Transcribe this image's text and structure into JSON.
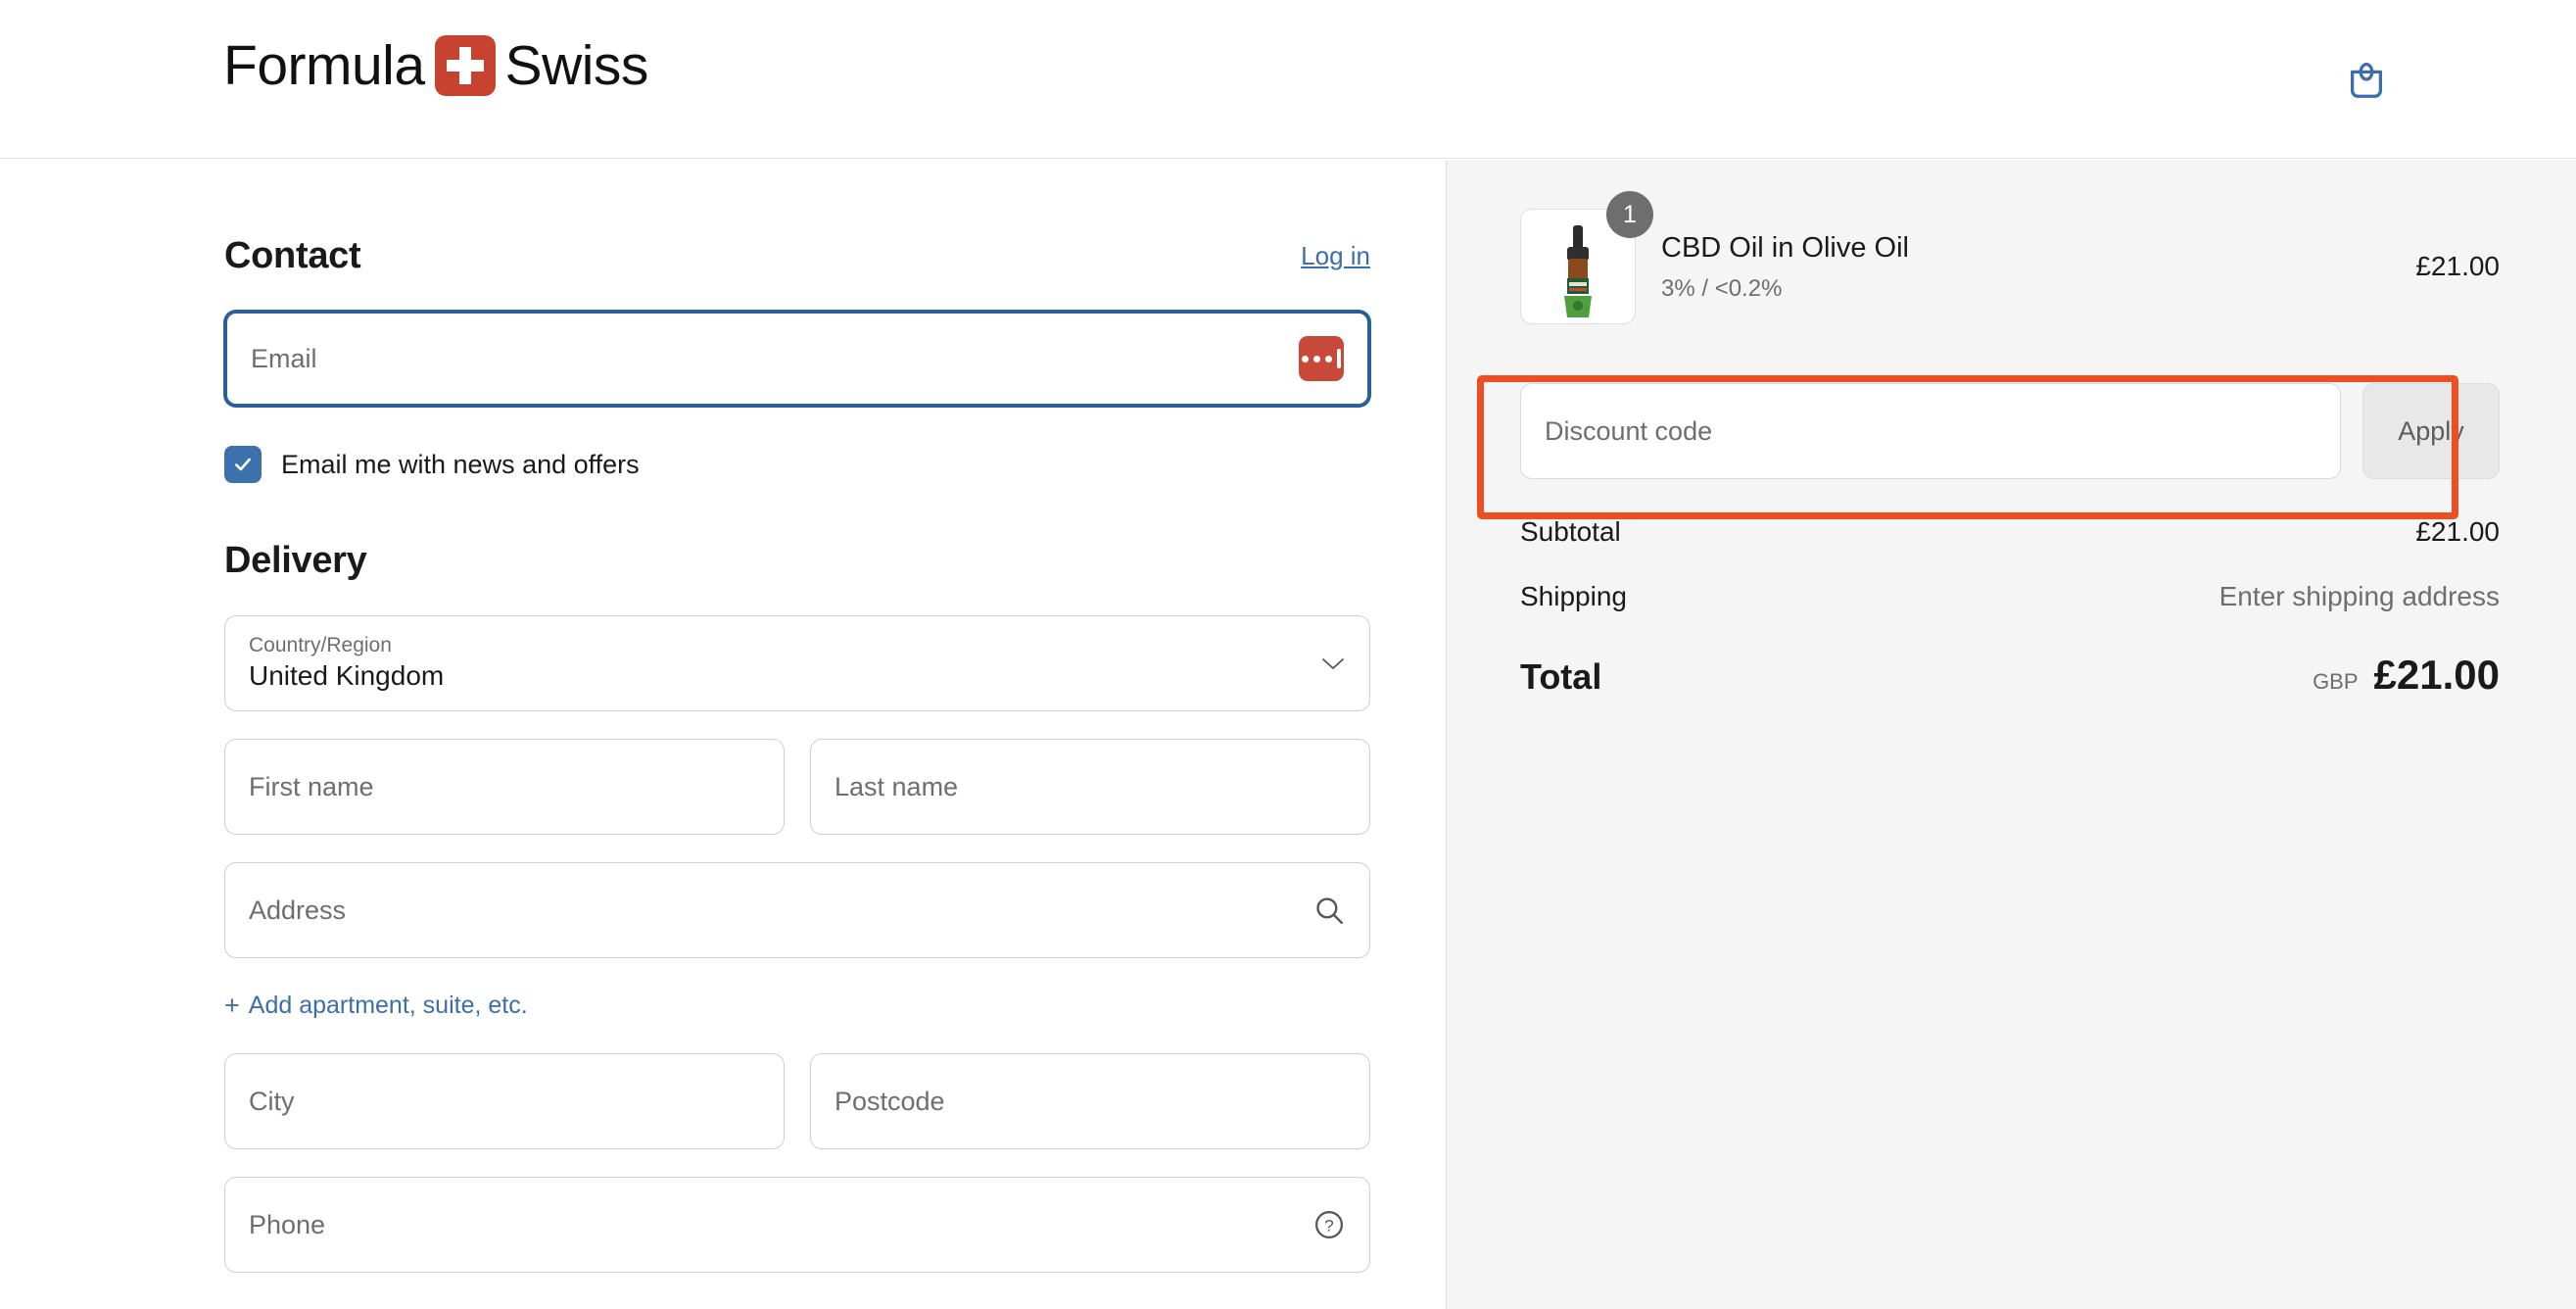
{
  "header": {
    "logo_text_left": "Formula",
    "logo_text_right": "Swiss",
    "logo_icon": "swiss-cross-icon",
    "cart_icon": "shopping-bag-icon",
    "brand_red": "#c8432f",
    "cart_icon_color": "#3b6eaa"
  },
  "contact": {
    "title": "Contact",
    "login_label": "Log in",
    "email_placeholder": "Email",
    "email_value": "",
    "autofill_icon": "password-manager-icon",
    "newsletter_label": "Email me with news and offers",
    "newsletter_checked": true
  },
  "delivery": {
    "title": "Delivery",
    "country_label": "Country/Region",
    "country_value": "United Kingdom",
    "country_chevron": "chevron-down-icon",
    "first_name_placeholder": "First name",
    "last_name_placeholder": "Last name",
    "address_placeholder": "Address",
    "address_icon": "search-icon",
    "add_apartment_label": "Add apartment, suite, etc.",
    "add_apartment_plus": "+",
    "city_placeholder": "City",
    "postcode_placeholder": "Postcode",
    "phone_placeholder": "Phone",
    "phone_icon": "help-circle-icon"
  },
  "summary": {
    "item": {
      "name": "CBD Oil in Olive Oil",
      "variant": "3% / <0.2%",
      "price": "£21.00",
      "quantity": "1",
      "image_alt": "cbd-oil-dropper-bottle"
    },
    "discount": {
      "placeholder": "Discount code",
      "value": "",
      "apply_label": "Apply",
      "highlight_color": "#ee4f22"
    },
    "totals": {
      "subtotal_label": "Subtotal",
      "subtotal_value": "£21.00",
      "shipping_label": "Shipping",
      "shipping_value": "Enter shipping address",
      "total_label": "Total",
      "total_currency": "GBP",
      "total_value": "£21.00"
    }
  }
}
